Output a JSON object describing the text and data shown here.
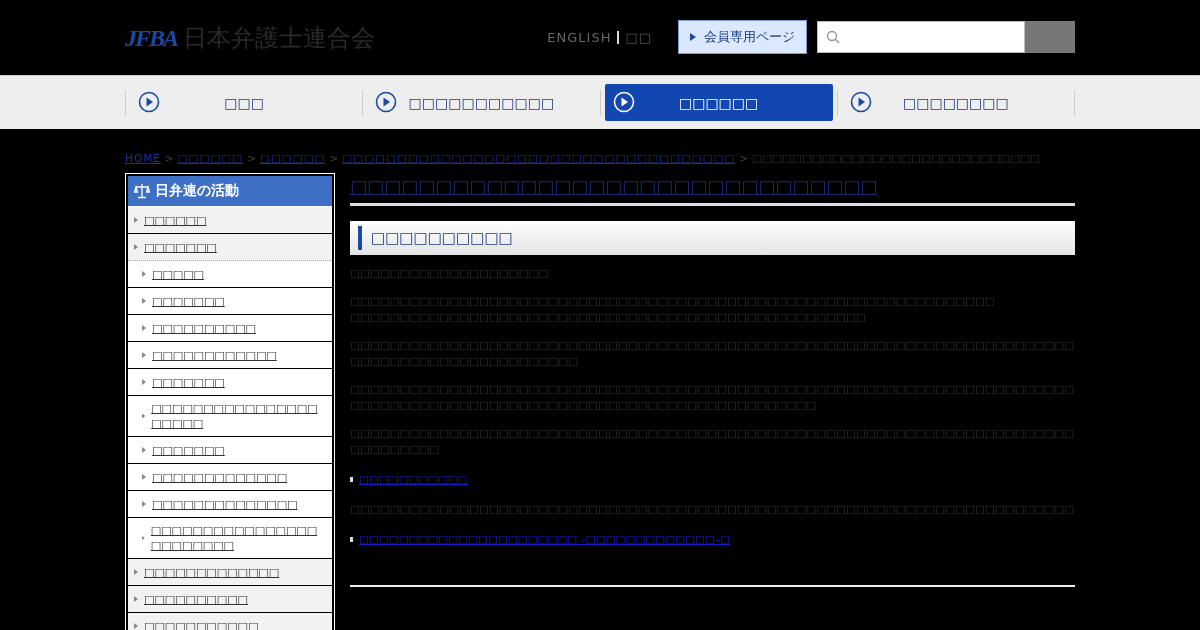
{
  "header": {
    "logo_mark": "JFBA",
    "logo_text": "日本弁護士連合会",
    "lang_links": [
      {
        "label": "ENGLISH",
        "selected": true
      },
      {
        "label": "□□",
        "selected": false
      }
    ],
    "member_button": "会員専用ページ"
  },
  "nav": [
    {
      "label": "□□□",
      "selected": false
    },
    {
      "label": "□□□□□□□□□□□",
      "selected": false
    },
    {
      "label": "□□□□□□",
      "selected": true
    },
    {
      "label": "□□□□□□□□",
      "selected": false
    }
  ],
  "breadcrumb": [
    {
      "label": "HOME",
      "kind": "link"
    },
    {
      "label": ">",
      "kind": "separator"
    },
    {
      "label": "□□□□□□",
      "kind": "link"
    },
    {
      "label": ">",
      "kind": "separator"
    },
    {
      "label": "□□□□□□",
      "kind": "link"
    },
    {
      "label": ">",
      "kind": "separator"
    },
    {
      "label": "□□□□□□□□□□□□□□□□□□□□□□□□□□□□□□□□□□□□",
      "kind": "link"
    },
    {
      "label": ">",
      "kind": "separator"
    },
    {
      "label": "□□□□□□□□□□□□□□□□□□□□□□□□□□□□□",
      "kind": "current"
    }
  ],
  "sidebar": {
    "title": "日弁連の活動",
    "items": [
      {
        "label": "□□□□□□",
        "expanded": false
      },
      {
        "label": "□□□□□□□",
        "expanded": true,
        "children": [
          {
            "label": "□□□□□"
          },
          {
            "label": "□□□□□□□"
          },
          {
            "label": "□□□□□□□□□□"
          },
          {
            "label": "□□□□□□□□□□□□"
          },
          {
            "label": "□□□□□□□"
          },
          {
            "label": "□□□□□□□□□□□□□□□□□□□□□"
          },
          {
            "label": "□□□□□□□"
          },
          {
            "label": "□□□□□□□□□□□□□"
          },
          {
            "label": "□□□□□□□□□□□□□□"
          },
          {
            "label": "□□□□□□□□□□□□□□□□□□□□□□□□"
          }
        ]
      },
      {
        "label": "□□□□□□□□□□□□□",
        "expanded": false
      },
      {
        "label": "□□□□□□□□□□",
        "expanded": false
      },
      {
        "label": "□□□□□□□□□□□",
        "expanded": false
      }
    ]
  },
  "main": {
    "title": "□□□□□□□□□□□□□□□□□□□□□□□□□□□□□□□",
    "section_heading": "□□□□□□□□□□",
    "blocks": [
      {
        "kind": "text",
        "text": "□□□□□□□□□□□□□□□□□□□□"
      },
      {
        "kind": "text",
        "text": "□□□□□□□□□□□□□□□□□□□□□□□□□□□□□□□□□□□□□□□□□□□□□□□□□□□□□□□□□□□□□□□□□\n□□□□□□□□□□□□□□□□□□□□□□□□□□□□□□□□□□□□□□□□□□□□□□□□□□□□"
      },
      {
        "kind": "text",
        "text": "□□□□□□□□□□□□□□□□□□□□□□□□□□□□□□□□□□□□□□□□□□□□□□□□□□□□□□□□□□□□□□□□□□□□□□□□□□□□□□□□□□□□□□□□□□□□□□□□"
      },
      {
        "kind": "text",
        "text": "□□□□□□□□□□□□□□□□□□□□□□□□□□□□□□□□□□□□□□□□□□□□□□□□□□□□□□□□□□□□□□□□□□□□□□□□□□□□□□□□□□□□□□□□□□□□□□□□□□□□□□□□□□□□□□□□□□□□□□□□"
      },
      {
        "kind": "text",
        "text": "□□□□□□□□□□□□□□□□□□□□□□□□□□□□□□□□□□□□□□□□□□□□□□□□□□□□□□□□□□□□□□□□□□□□□□□□□□□□□□□□□□"
      },
      {
        "kind": "link",
        "text": "□□□□□□□□□□□"
      },
      {
        "kind": "text",
        "text": "□□□□□□□□□□□□□□□□□□□□□□□□□□□□□□□□□□□□□□□□□□□□□□□□□□□□□□□□□□□□□□□□□□□□□□□□□"
      },
      {
        "kind": "link",
        "text": "□□□□□□□□□□□□□□□□□□□□□□ –□□□□□□□□□□□□□–□"
      }
    ]
  }
}
